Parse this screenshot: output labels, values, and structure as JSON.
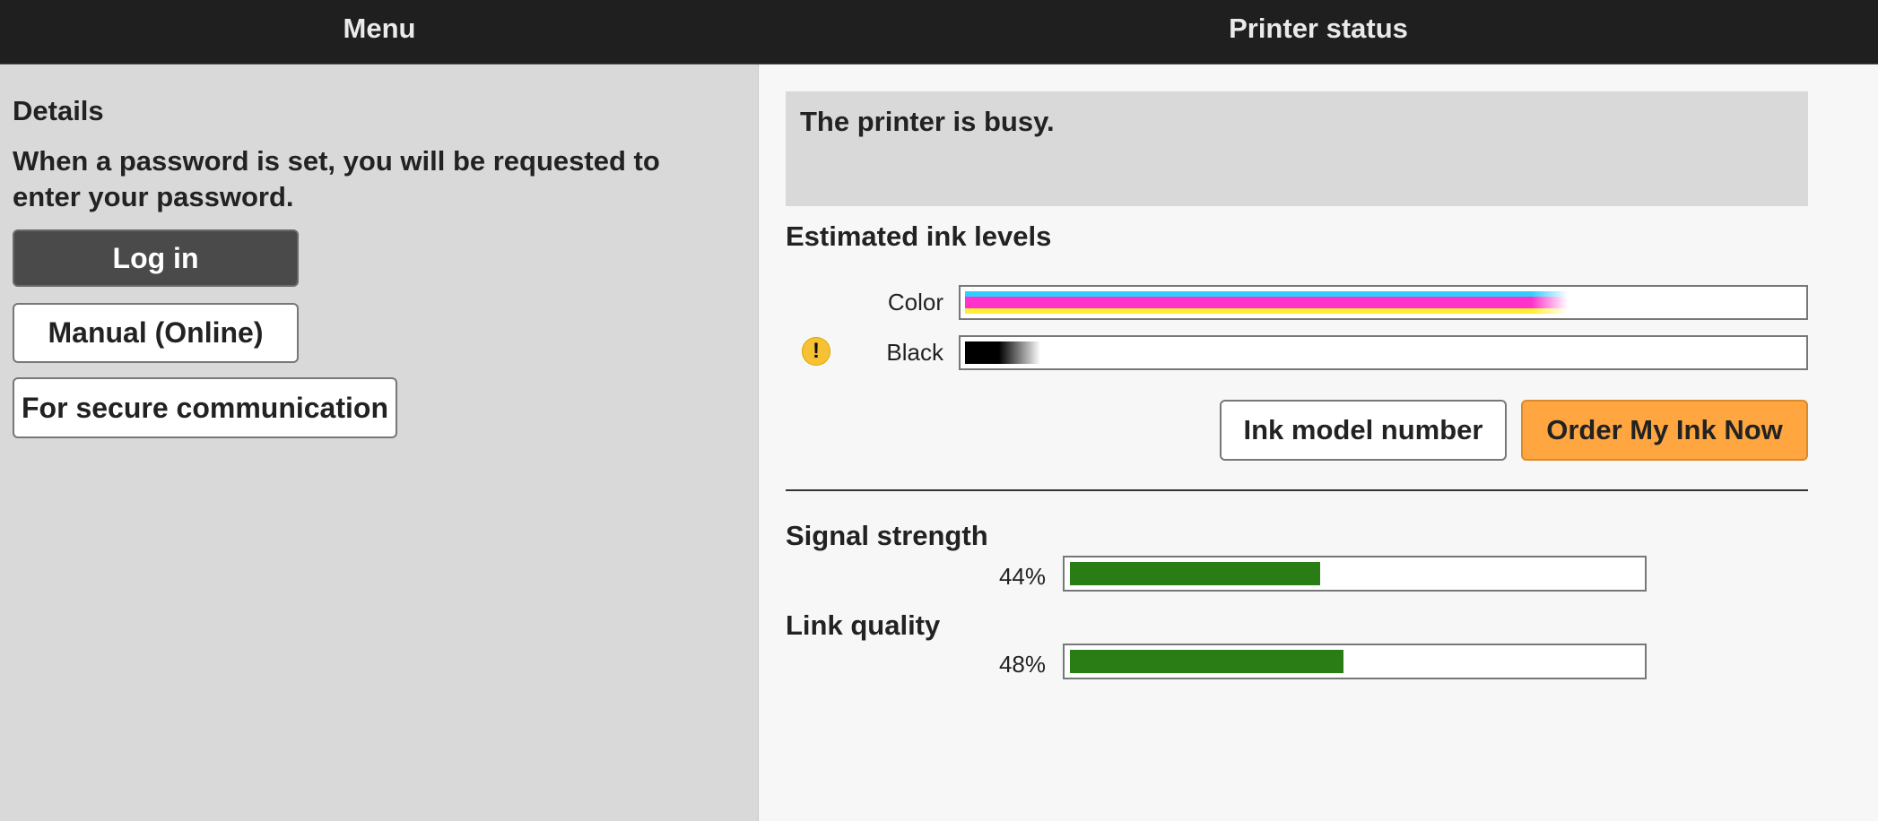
{
  "header": {
    "menu_title": "Menu",
    "status_title": "Printer status"
  },
  "sidebar": {
    "details_heading": "Details",
    "details_text": "When a password is set, you will be requested to enter your password.",
    "login_label": "Log in",
    "manual_label": "Manual (Online)",
    "secure_label": "For secure communication"
  },
  "status": {
    "message": "The printer is busy."
  },
  "ink": {
    "heading": "Estimated ink levels",
    "color_label": "Color",
    "black_label": "Black",
    "color_level": 0.72,
    "black_level": 0.09,
    "black_warning_icon": "exclamation-warning-icon",
    "colors": {
      "cyan": "#33ccff",
      "magenta": "#ff33cc",
      "yellow": "#ffee33",
      "black": "#000000"
    },
    "model_button": "Ink model number",
    "order_button": "Order My Ink Now"
  },
  "network": {
    "signal_heading": "Signal strength",
    "signal_value": "44%",
    "signal_level": 0.44,
    "link_heading": "Link quality",
    "link_value": "48%",
    "link_level": 0.48,
    "bar_color": "#2a7d14"
  },
  "accent": {
    "order_button_bg": "#ffa640",
    "login_button_bg": "#4a4a4a"
  }
}
